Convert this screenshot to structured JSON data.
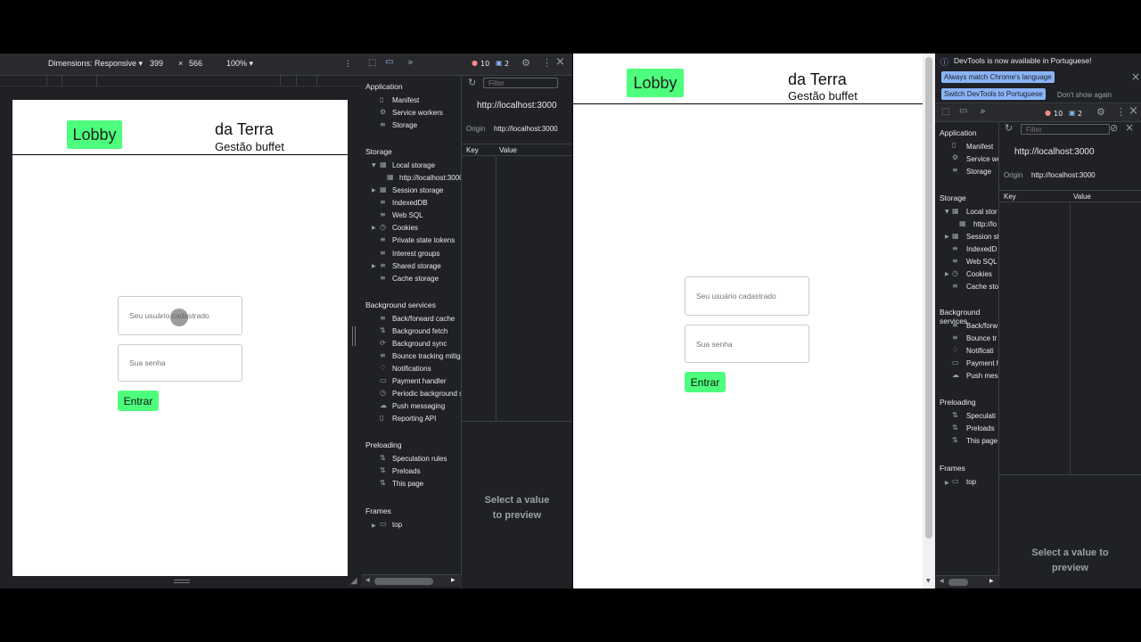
{
  "device_toolbar": {
    "dimensions_label": "Dimensions: Responsive ▾",
    "width": "399",
    "times": "×",
    "height": "566",
    "zoom": "100% ▾",
    "more": "⋮"
  },
  "devtools": {
    "errors_count": "10",
    "messages_count": "2",
    "sections": {
      "application": "Application",
      "storage": "Storage",
      "background_services": "Background services",
      "preloading": "Preloading",
      "frames": "Frames"
    },
    "application_items": [
      "Manifest",
      "Service workers",
      "Storage"
    ],
    "storage_items": [
      "Local storage",
      "http://localhost:3000",
      "Session storage",
      "IndexedDB",
      "Web SQL",
      "Cookies",
      "Private state tokens",
      "Interest groups",
      "Shared storage",
      "Cache storage"
    ],
    "background_items": [
      "Back/forward cache",
      "Background fetch",
      "Background sync",
      "Bounce tracking mitigations",
      "Notifications",
      "Payment handler",
      "Periodic background sync",
      "Push messaging",
      "Reporting API"
    ],
    "preloading_items": [
      "Speculation rules",
      "Preloads",
      "This page"
    ],
    "frames_items": [
      "top"
    ],
    "filter_placeholder": "Filter",
    "origin_url": "http://localhost:3000",
    "origin_label": "Origin",
    "origin_value": "http://localhost:3000",
    "col_key": "Key",
    "col_value": "Value",
    "preview_line1": "Select a value",
    "preview_line2": "to preview",
    "right_preview_line1": "Select a value to",
    "right_preview_line2": "preview"
  },
  "right_devtools": {
    "storage_items": [
      "Local stor",
      "http://lo",
      "Session st",
      "IndexedD",
      "Web SQL",
      "Cookies",
      "Cache sto"
    ],
    "background_items": [
      "Back/forw",
      "Bounce tr",
      "Notificati",
      "Payment h",
      "Push mes"
    ],
    "preloading_items": [
      "Speculati",
      "Preloads",
      "This page"
    ]
  },
  "infobar": {
    "message": "DevTools is now available in Portuguese!",
    "btn_match": "Always match Chrome's language",
    "btn_switch": "Switch DevTools to Portuguese",
    "dont_show": "Don't show again",
    "close": "×"
  },
  "app": {
    "lobby_label": "Lobby",
    "brand_title": "da Terra",
    "brand_subtitle": "Gestão buffet",
    "username_placeholder": "Seu usuário cadastrado",
    "password_placeholder": "Sua senha",
    "submit_label": "Entrar"
  },
  "icons": {
    "inspect": "⬚",
    "device": "▭",
    "more_tabs": "»",
    "gear": "⚙",
    "kebab": "⋮",
    "close": "×",
    "refresh": "↻",
    "clear": "⊘",
    "file": "▯",
    "gear_small": "⚙",
    "db": "≡",
    "table": "▦",
    "arrows": "⇅",
    "sync": "⟳",
    "bell": "♢",
    "card": "▭",
    "clock": "◷",
    "cloud": "☁",
    "frame": "▭",
    "tri_down": "▼",
    "tri_right": "▶",
    "scroll_left": "◀",
    "scroll_right": "▶",
    "scroll_down": "▼",
    "info": "ⓘ",
    "corner": "◢",
    "error_dot": "●",
    "msg_icon": "▣"
  },
  "colors": {
    "accent_green": "#4dff7c",
    "devtools_bg": "#202124",
    "info_button": "#8ab4f8",
    "error_red": "#f28b82"
  }
}
